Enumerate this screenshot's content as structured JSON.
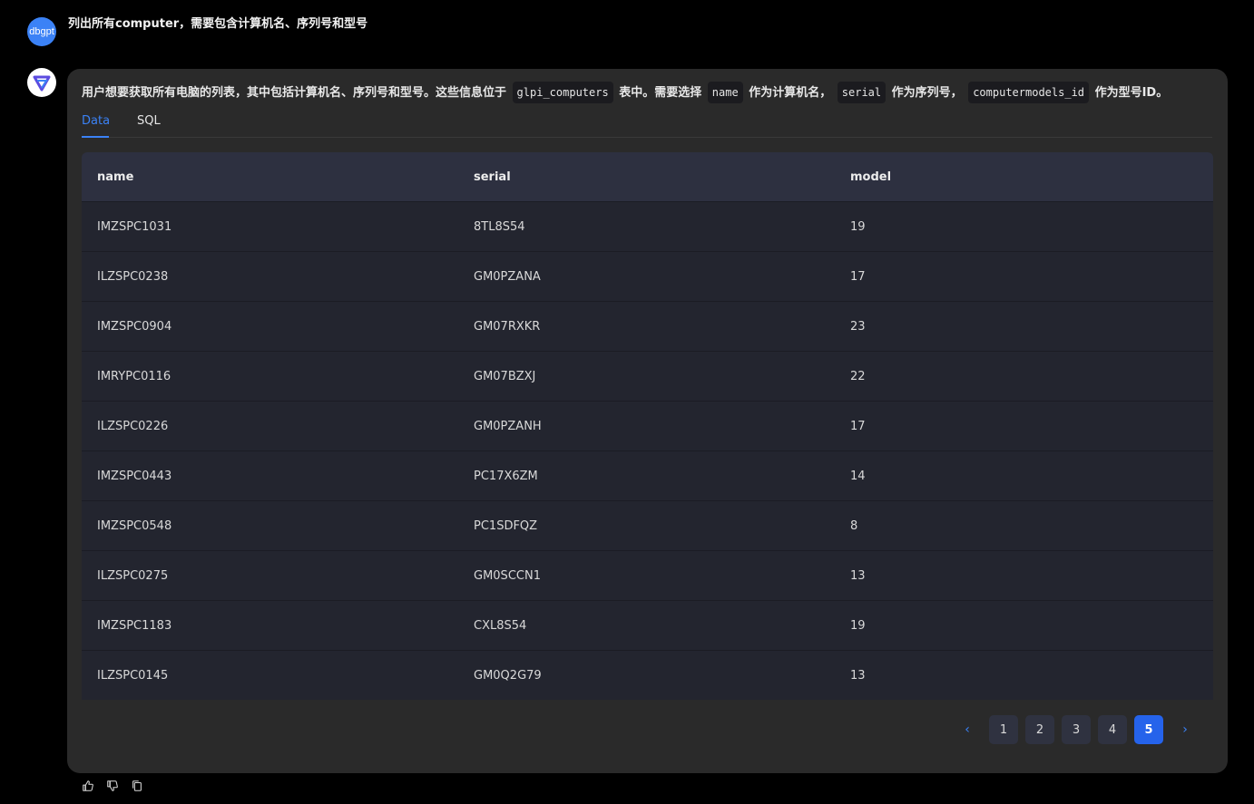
{
  "user": {
    "avatar_label": "dbgpt",
    "message": "列出所有computer，需要包含计算机名、序列号和型号"
  },
  "reply": {
    "intro_parts": {
      "p1": "用户想要获取所有电脑的列表，其中包括计算机名、序列号和型号。这些信息位于",
      "c1": "glpi_computers",
      "p2": "表中。需要选择",
      "c2": "name",
      "p3": "作为计算机名，",
      "c3": "serial",
      "p4": "作为序列号，",
      "c4": "computermodels_id",
      "p5": "作为型号ID。"
    },
    "tabs": {
      "data": "Data",
      "sql": "SQL"
    },
    "table": {
      "headers": [
        "name",
        "serial",
        "model"
      ],
      "rows": [
        [
          "IMZSPC1031",
          "8TL8S54",
          "19"
        ],
        [
          "ILZSPC0238",
          "GM0PZANA",
          "17"
        ],
        [
          "IMZSPC0904",
          "GM07RXKR",
          "23"
        ],
        [
          "IMRYPC0116",
          "GM07BZXJ",
          "22"
        ],
        [
          "ILZSPC0226",
          "GM0PZANH",
          "17"
        ],
        [
          "IMZSPC0443",
          "PC17X6ZM",
          "14"
        ],
        [
          "IMZSPC0548",
          "PC1SDFQZ",
          "8"
        ],
        [
          "ILZSPC0275",
          "GM0SCCN1",
          "13"
        ],
        [
          "IMZSPC1183",
          "CXL8S54",
          "19"
        ],
        [
          "ILZSPC0145",
          "GM0Q2G79",
          "13"
        ]
      ]
    },
    "pagination": {
      "prev": "‹",
      "next": "›",
      "pages": [
        "1",
        "2",
        "3",
        "4",
        "5"
      ],
      "current": "5"
    }
  },
  "icons": {
    "like": "thumbs-up-icon",
    "dislike": "thumbs-down-icon",
    "copy": "copy-icon"
  },
  "colors": {
    "accent": "#3b82f6",
    "active_page": "#2563eb",
    "bubble_bg": "#2a2a2a",
    "header_bg": "#2d3040",
    "row_bg": "#23252f"
  }
}
